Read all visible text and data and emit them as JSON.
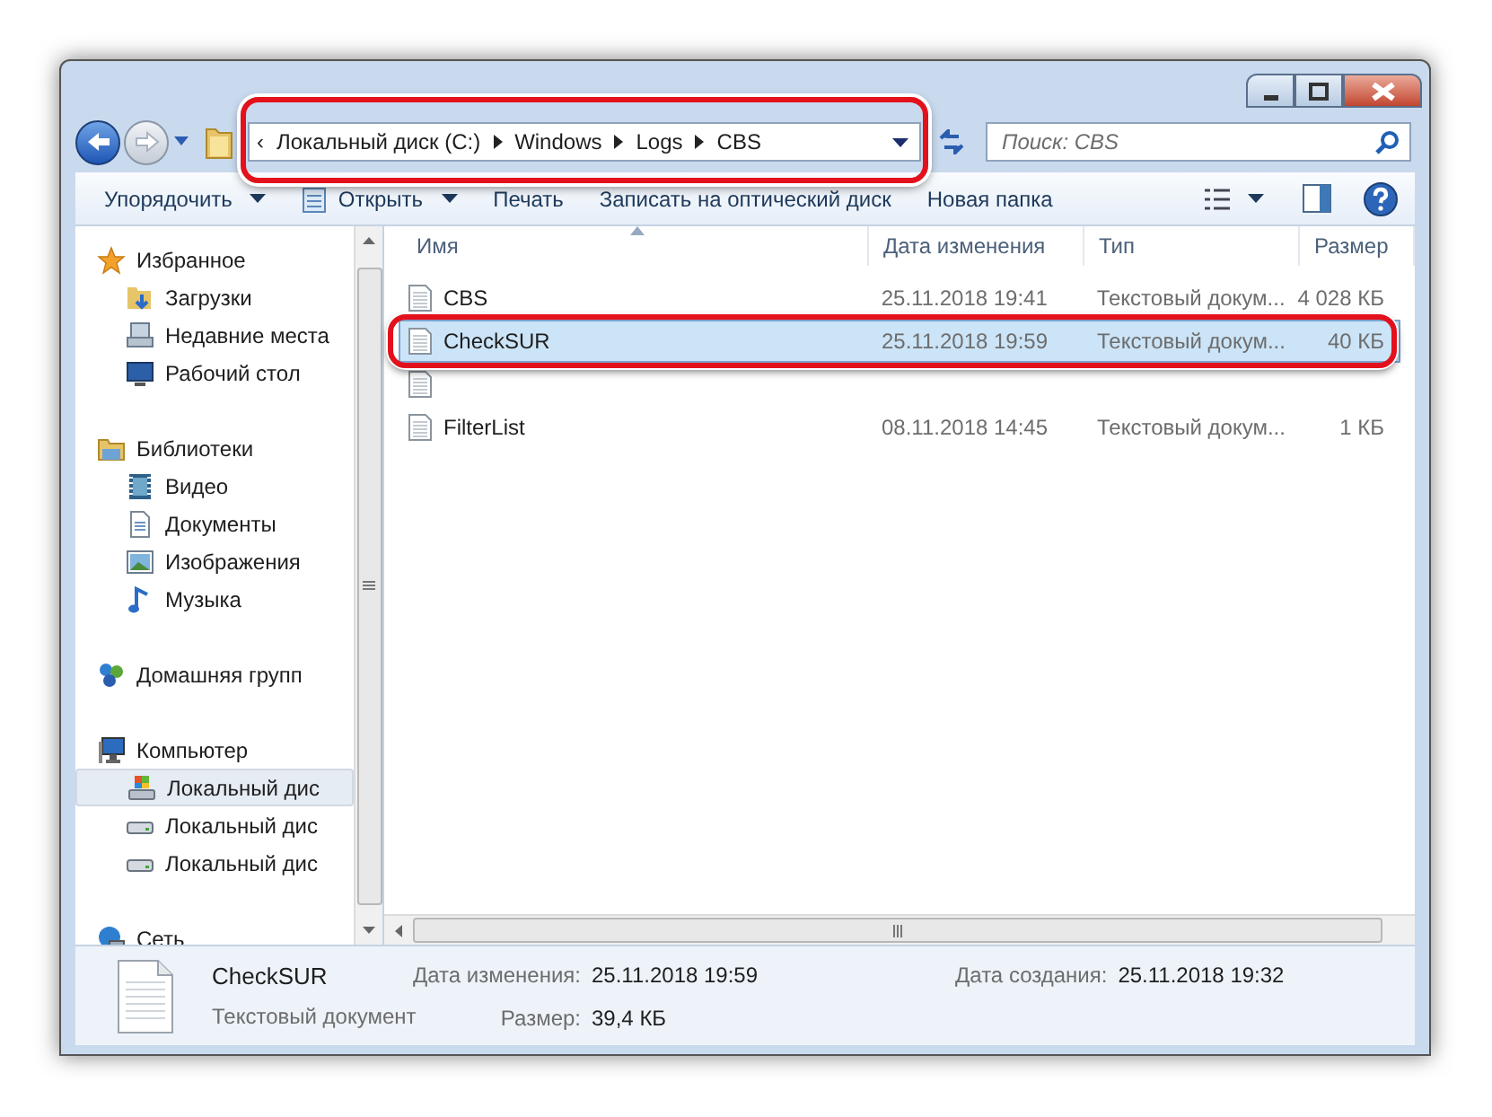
{
  "address_bar": {
    "overflow_mark": "‹",
    "crumbs": [
      "Локальный диск (C:)",
      "Windows",
      "Logs",
      "CBS"
    ],
    "highlighted": true
  },
  "search": {
    "placeholder": "Поиск: CBS"
  },
  "toolbar": [
    {
      "label": "Упорядочить",
      "kind": "menu"
    },
    {
      "label": "Открыть",
      "kind": "open"
    },
    {
      "label": "Печать",
      "kind": "plain"
    },
    {
      "label": "Записать на оптический диск",
      "kind": "plain"
    },
    {
      "label": "Новая папка",
      "kind": "plain"
    }
  ],
  "sidebar": {
    "groups": [
      {
        "label": "Избранное",
        "kind": "star",
        "children": [
          {
            "label": "Загрузки",
            "kind": "downloads",
            "selected": false
          },
          {
            "label": "Недавние места",
            "kind": "recent",
            "selected": false
          },
          {
            "label": "Рабочий стол",
            "kind": "desktop",
            "selected": false
          }
        ]
      },
      {
        "label": "Библиотеки",
        "kind": "library",
        "children": [
          {
            "label": "Видео",
            "kind": "video",
            "selected": false
          },
          {
            "label": "Документы",
            "kind": "document",
            "selected": false
          },
          {
            "label": "Изображения",
            "kind": "picture",
            "selected": false
          },
          {
            "label": "Музыка",
            "kind": "music",
            "selected": false
          }
        ]
      },
      {
        "label": "Домашняя групп",
        "kind": "homegroup"
      },
      {
        "label": "Компьютер",
        "kind": "computer",
        "children": [
          {
            "label": "Локальный дис",
            "kind": "systemdrive",
            "selected": true
          },
          {
            "label": "Локальный дис",
            "kind": "drive",
            "selected": false
          },
          {
            "label": "Локальный дис",
            "kind": "drive",
            "selected": false
          }
        ]
      },
      {
        "label": "Сеть",
        "kind": "network"
      }
    ]
  },
  "file_list": {
    "columns": [
      "Имя",
      "Дата изменения",
      "Тип",
      "Размер"
    ],
    "highlighted": true,
    "rows": [
      {
        "kind": "file",
        "name": "CBS",
        "modified": "25.11.2018 19:41",
        "type": "Текстовый докум...",
        "size": "4 028 КБ",
        "selected": false
      },
      {
        "kind": "file",
        "name": "CheckSUR",
        "modified": "25.11.2018 19:59",
        "type": "Текстовый докум...",
        "size": "40 КБ",
        "selected": true
      },
      {
        "kind": "obscured",
        "selected": false
      },
      {
        "kind": "file",
        "name": "FilterList",
        "modified": "08.11.2018 14:45",
        "type": "Текстовый докум...",
        "size": "1 КБ",
        "selected": false
      }
    ]
  },
  "details": {
    "name": "CheckSUR",
    "type": "Текстовый документ",
    "fields": [
      {
        "label": "Дата изменения:",
        "value": "25.11.2018 19:59"
      },
      {
        "label": "Размер:",
        "value": "39,4 КБ"
      },
      {
        "label": "Дата создания:",
        "value": "25.11.2018 19:32"
      }
    ]
  }
}
